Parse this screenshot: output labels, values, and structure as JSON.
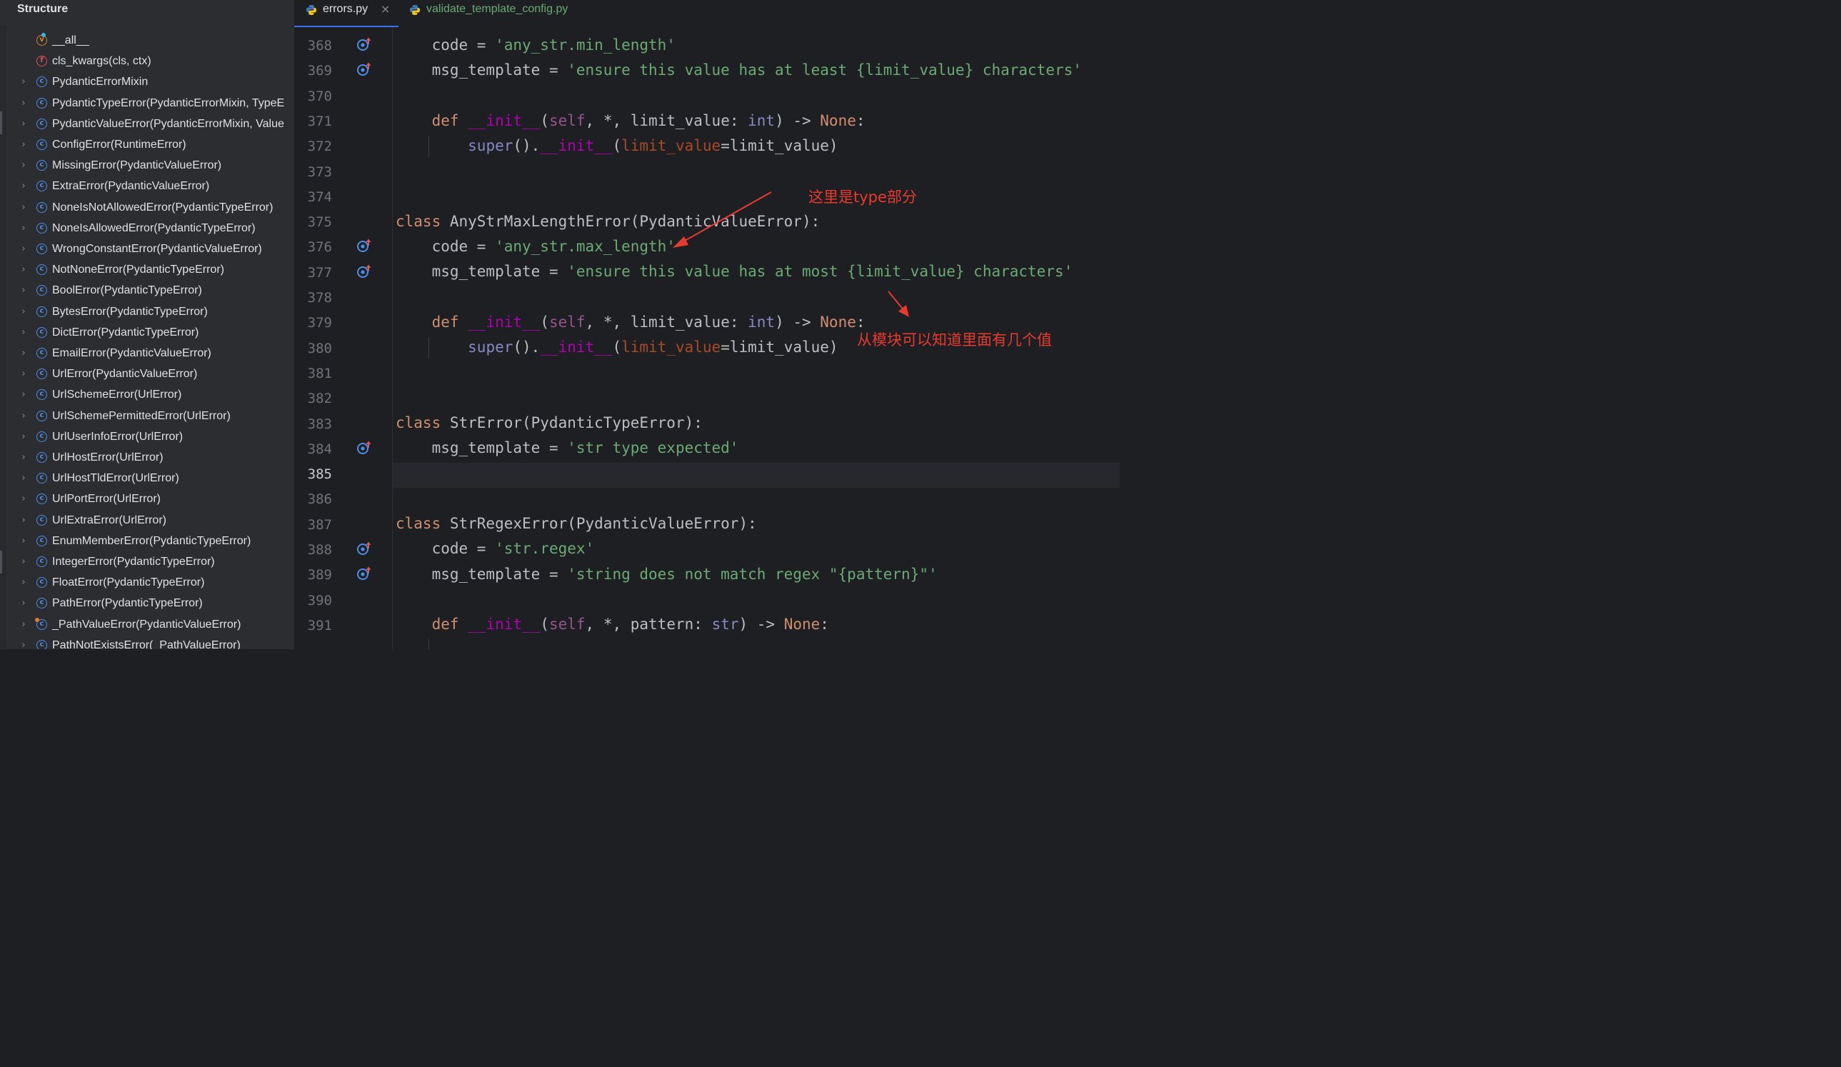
{
  "structure": {
    "title": "Structure",
    "items": [
      {
        "label": "__all__",
        "kind": "variable",
        "expandable": false
      },
      {
        "label": "cls_kwargs(cls, ctx)",
        "kind": "function",
        "expandable": false
      },
      {
        "label": "PydanticErrorMixin",
        "kind": "class",
        "expandable": true
      },
      {
        "label": "PydanticTypeError(PydanticErrorMixin, TypeE",
        "kind": "class",
        "expandable": true
      },
      {
        "label": "PydanticValueError(PydanticErrorMixin, Value",
        "kind": "class",
        "expandable": true
      },
      {
        "label": "ConfigError(RuntimeError)",
        "kind": "class",
        "expandable": true
      },
      {
        "label": "MissingError(PydanticValueError)",
        "kind": "class",
        "expandable": true
      },
      {
        "label": "ExtraError(PydanticValueError)",
        "kind": "class",
        "expandable": true
      },
      {
        "label": "NoneIsNotAllowedError(PydanticTypeError)",
        "kind": "class",
        "expandable": true
      },
      {
        "label": "NoneIsAllowedError(PydanticTypeError)",
        "kind": "class",
        "expandable": true
      },
      {
        "label": "WrongConstantError(PydanticValueError)",
        "kind": "class",
        "expandable": true
      },
      {
        "label": "NotNoneError(PydanticTypeError)",
        "kind": "class",
        "expandable": true
      },
      {
        "label": "BoolError(PydanticTypeError)",
        "kind": "class",
        "expandable": true
      },
      {
        "label": "BytesError(PydanticTypeError)",
        "kind": "class",
        "expandable": true
      },
      {
        "label": "DictError(PydanticTypeError)",
        "kind": "class",
        "expandable": true
      },
      {
        "label": "EmailError(PydanticValueError)",
        "kind": "class",
        "expandable": true
      },
      {
        "label": "UrlError(PydanticValueError)",
        "kind": "class",
        "expandable": true
      },
      {
        "label": "UrlSchemeError(UrlError)",
        "kind": "class",
        "expandable": true
      },
      {
        "label": "UrlSchemePermittedError(UrlError)",
        "kind": "class",
        "expandable": true
      },
      {
        "label": "UrlUserInfoError(UrlError)",
        "kind": "class",
        "expandable": true
      },
      {
        "label": "UrlHostError(UrlError)",
        "kind": "class",
        "expandable": true
      },
      {
        "label": "UrlHostTldError(UrlError)",
        "kind": "class",
        "expandable": true
      },
      {
        "label": "UrlPortError(UrlError)",
        "kind": "class",
        "expandable": true
      },
      {
        "label": "UrlExtraError(UrlError)",
        "kind": "class",
        "expandable": true
      },
      {
        "label": "EnumMemberError(PydanticTypeError)",
        "kind": "class",
        "expandable": true
      },
      {
        "label": "IntegerError(PydanticTypeError)",
        "kind": "class",
        "expandable": true
      },
      {
        "label": "FloatError(PydanticTypeError)",
        "kind": "class",
        "expandable": true
      },
      {
        "label": "PathError(PydanticTypeError)",
        "kind": "class",
        "expandable": true
      },
      {
        "label": "_PathValueError(PydanticValueError)",
        "kind": "class-private",
        "expandable": true
      },
      {
        "label": "PathNotExistsError(_PathValueError)",
        "kind": "class",
        "expandable": true
      }
    ]
  },
  "tabs": [
    {
      "label": "errors.py",
      "active": true,
      "icon": "python-icon",
      "closable": true
    },
    {
      "label": "validate_template_config.py",
      "active": false,
      "icon": "python-icon",
      "closable": false
    }
  ],
  "editor": {
    "current_line": "385",
    "lines": [
      {
        "n": "368",
        "override": true
      },
      {
        "n": "369",
        "override": true
      },
      {
        "n": "370",
        "override": false
      },
      {
        "n": "371",
        "override": false
      },
      {
        "n": "372",
        "override": false
      },
      {
        "n": "373",
        "override": false
      },
      {
        "n": "374",
        "override": false
      },
      {
        "n": "375",
        "override": false
      },
      {
        "n": "376",
        "override": true
      },
      {
        "n": "377",
        "override": true
      },
      {
        "n": "378",
        "override": false
      },
      {
        "n": "379",
        "override": false
      },
      {
        "n": "380",
        "override": false
      },
      {
        "n": "381",
        "override": false
      },
      {
        "n": "382",
        "override": false
      },
      {
        "n": "383",
        "override": false
      },
      {
        "n": "384",
        "override": true
      },
      {
        "n": "385",
        "override": false
      },
      {
        "n": "386",
        "override": false
      },
      {
        "n": "387",
        "override": false
      },
      {
        "n": "388",
        "override": true
      },
      {
        "n": "389",
        "override": true
      },
      {
        "n": "390",
        "override": false
      },
      {
        "n": "391",
        "override": false
      }
    ],
    "code": {
      "l368_name": "code",
      "l368_op": " = ",
      "l368_val": "'any_str.min_length'",
      "l369_name": "msg_template",
      "l369_op": " = ",
      "l369_val": "'ensure this value has at least {limit_value} characters'",
      "l371_def": "def ",
      "l371_init": "__init__",
      "l371_p1": "(",
      "l371_self": "self",
      "l371_p2": ", *, limit_value: ",
      "l371_int": "int",
      "l371_p3": ") -> ",
      "l371_none": "None",
      "l371_p4": ":",
      "l372_super": "super",
      "l372_p1": "().",
      "l372_init": "__init__",
      "l372_p2": "(",
      "l372_kw": "limit_value",
      "l372_p3": "=limit_value)",
      "l375_class": "class ",
      "l375_rest": "AnyStrMaxLengthError(PydanticValueError):",
      "l376_name": "code",
      "l376_op": " = ",
      "l376_val": "'any_str.max_length'",
      "l377_name": "msg_template",
      "l377_op": " = ",
      "l377_val": "'ensure this value has at most {limit_value} characters'",
      "l379_def": "def ",
      "l379_init": "__init__",
      "l379_p1": "(",
      "l379_self": "self",
      "l379_p2": ", *, limit_value: ",
      "l379_int": "int",
      "l379_p3": ") -> ",
      "l379_none": "None",
      "l379_p4": ":",
      "l380_super": "super",
      "l380_p1": "().",
      "l380_init": "__init__",
      "l380_p2": "(",
      "l380_kw": "limit_value",
      "l380_p3": "=limit_value)",
      "l383_class": "class ",
      "l383_rest": "StrError(PydanticTypeError):",
      "l384_name": "msg_template",
      "l384_op": " = ",
      "l384_val": "'str type expected'",
      "l387_class": "class ",
      "l387_rest": "StrRegexError(PydanticValueError):",
      "l388_name": "code",
      "l388_op": " = ",
      "l388_val": "'str.regex'",
      "l389_name": "msg_template",
      "l389_op": " = ",
      "l389_val": "'string does not match regex \"{pattern}\"'",
      "l391_def": "def ",
      "l391_init": "__init__",
      "l391_p1": "(",
      "l391_self": "self",
      "l391_p2": ", *, pattern: ",
      "l391_str": "str",
      "l391_p3": ") -> ",
      "l391_none": "None",
      "l391_p4": ":"
    },
    "annotations": {
      "type_part": "这里是type部分",
      "module_count": "从模块可以知道里面有几个值",
      "color": "#e83a2e"
    }
  },
  "colors": {
    "keyword": "#cf8e6d",
    "string": "#6aab73",
    "dunder": "#b200b2",
    "accent": "#3574f0"
  }
}
